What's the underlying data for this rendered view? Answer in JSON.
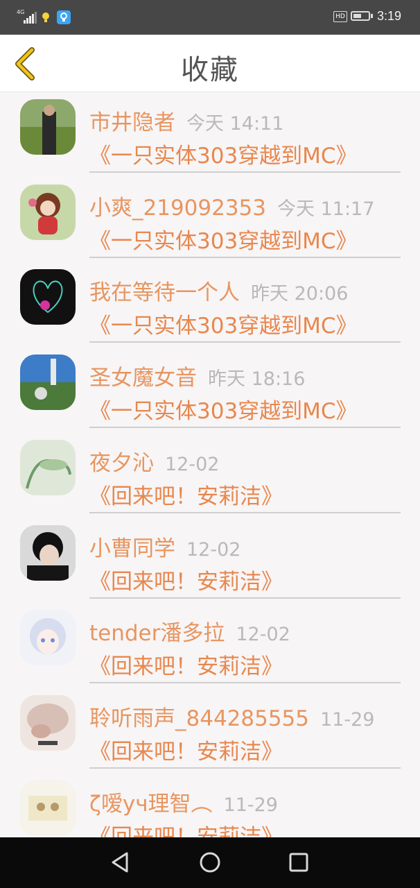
{
  "status_bar": {
    "network": "4G",
    "time": "3:19",
    "hd": "HD",
    "battery_level": 0.55,
    "icons": [
      "signal-icon",
      "notification-icon",
      "app-notification-icon",
      "hd-icon",
      "battery-icon"
    ]
  },
  "header": {
    "back_icon": "chevron-left-icon",
    "title": "收藏"
  },
  "items": [
    {
      "user": "市井隐者",
      "time": "今天 14:11",
      "book": "《一只实体303穿越到MC》"
    },
    {
      "user": "小爽_219092353",
      "time": "今天 11:17",
      "book": "《一只实体303穿越到MC》"
    },
    {
      "user": "我在等待一个人",
      "time": "昨天 20:06",
      "book": "《一只实体303穿越到MC》"
    },
    {
      "user": "圣女魔女音",
      "time": "昨天 18:16",
      "book": "《一只实体303穿越到MC》"
    },
    {
      "user": "夜夕沁",
      "time": "12-02",
      "book": "《回来吧！安莉洁》"
    },
    {
      "user": "小曹同学",
      "time": "12-02",
      "book": "《回来吧！安莉洁》"
    },
    {
      "user": "tender潘多拉",
      "time": "12-02",
      "book": "《回来吧！安莉洁》"
    },
    {
      "user": "聆听雨声_844285555",
      "time": "11-29",
      "book": "《回来吧！安莉洁》"
    },
    {
      "user": "ζ嗳yч理智︵",
      "time": "11-29",
      "book": "《回来吧！安莉洁》"
    }
  ],
  "nav": [
    "back-triangle-icon",
    "home-circle-icon",
    "recent-square-icon"
  ],
  "colors": {
    "accent": "#e8874d",
    "timestamp": "#b9b9b9",
    "title": "#555555",
    "back_icon": "#e6b800"
  }
}
